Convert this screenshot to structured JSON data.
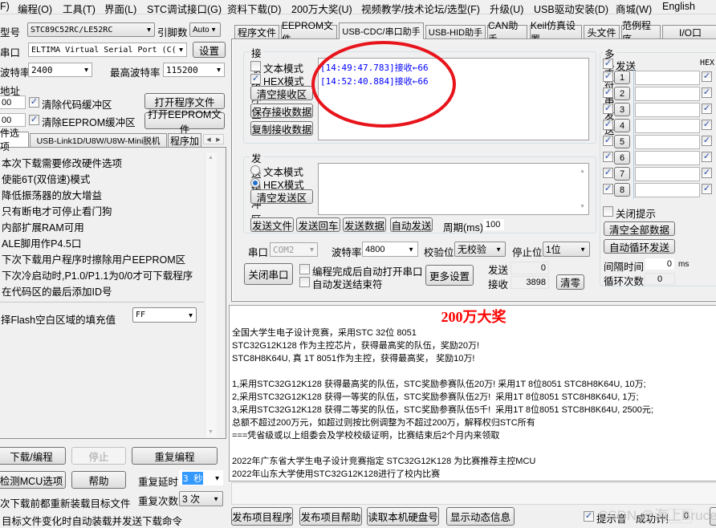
{
  "menu": [
    "F)",
    "编程(O)",
    "工具(T)",
    "界面(L)",
    "STC调试接口(G)",
    "资料下载(D)",
    "200万大奖(U)",
    "视频教学/技术论坛/选型(F)",
    "升级(U)",
    "USB驱动安装(D)",
    "商城(W)",
    "English"
  ],
  "left": {
    "chip_label": "型号",
    "chip_value": "STC89C52RC/LE52RC",
    "pins_label": "引脚数",
    "pins_value": "Auto",
    "port_label": "串口",
    "port_value": "ELTIMA Virtual Serial Port (C(",
    "settings_btn": "设置",
    "baud_label": "波特率",
    "baud_value": "2400",
    "max_baud_label": "最高波特率",
    "max_baud_value": "115200",
    "addr_label": "地址",
    "addr1": "00",
    "addr2": "00",
    "clear_code": "清除代码缓冲区",
    "clear_eeprom": "清除EEPROM缓冲区",
    "open_prog": "打开程序文件",
    "open_eeprom": "打开EEPROM文件",
    "tabs": [
      "件选项",
      "USB-Link1D/U8W/U8W-Mini脱机",
      "程序加"
    ],
    "options": [
      "本次下载需要修改硬件选项",
      "使能6T(双倍速)模式",
      "降低振荡器的放大增益",
      "只有断电才可停止看门狗",
      "内部扩展RAM可用",
      "ALE脚用作P4.5口",
      "下次下载用户程序时擦除用户EEPROM区",
      "下次冷启动时,P1.0/P1.1为0/0才可下载程序",
      "在代码区的最后添加ID号"
    ],
    "fill_label": "择Flash空白区域的填充值",
    "fill_value": "FF",
    "download_btn": "下载/编程",
    "stop_btn": "停止",
    "repeat_btn": "重复编程",
    "detect_btn": "检测MCU选项",
    "help_btn": "帮助",
    "delay_label": "重复延时",
    "delay_value": "3 秒",
    "count_label": "重复次数",
    "count_value": "3 次",
    "reload_text": "次下载前都重新装载目标文件",
    "auto_text": "目标文件变化时自动装载并发送下载命令"
  },
  "tabs": [
    "程序文件",
    "EEPROM文件",
    "USB-CDC/串口助手",
    "USB-HID助手",
    "CAN助手",
    "Keil仿真设置",
    "头文件",
    "范例程序",
    "I/O口"
  ],
  "recv": {
    "title": "接收缓冲区",
    "text_mode": "文本模式",
    "hex_mode": "HEX模式",
    "clear": "清空接收区",
    "save": "保存接收数据",
    "copy": "复制接收数据",
    "lines": [
      "[14:49:47.783]接收←66",
      "[14:52:40.884]接收←66"
    ],
    "text_color": "#0000ff",
    "annotation_color": "#e8141c"
  },
  "send": {
    "title": "发送缓冲区",
    "text_mode": "文本模式",
    "hex_mode": "HEX模式",
    "clear": "清空发送区",
    "send_file": "发送文件",
    "send_cr": "发送回车",
    "send_data": "发送数据",
    "auto_send": "自动发送",
    "period_label": "周期(ms)",
    "period_value": "100"
  },
  "serial": {
    "port_label": "串口",
    "port_value": "COM2",
    "baud_label": "波特率",
    "baud_value": "4800",
    "parity_label": "校验位",
    "parity_value": "无校验",
    "stop_label": "停止位",
    "stop_value": "1位",
    "close_btn": "关闭串口",
    "auto_open": "编程完成后自动打开串口",
    "auto_end": "自动发送结束符",
    "more_btn": "更多设置",
    "sent_label": "发送",
    "sent_value": "0",
    "recv_label": "接收",
    "recv_value": "3898",
    "clear_btn": "清零"
  },
  "multi": {
    "title": "多字符串发送",
    "send_label": "发送",
    "hex_label": "HEX",
    "rows": [
      "1",
      "2",
      "3",
      "4",
      "5",
      "6",
      "7",
      "8"
    ],
    "close_tip": "关闭提示",
    "clear_all": "清空全部数据",
    "loop_send": "自动循环发送",
    "interval_label": "间隔时间",
    "interval_value": "0",
    "interval_unit": "ms",
    "loop_label": "循环次数",
    "loop_value": "0"
  },
  "info": {
    "title": "200万大奖",
    "title_color": "#ff0000",
    "lines": [
      "全国大学生电子设计竞赛，采用STC 32位 8051",
      "STC32G12K128 作为主控芯片，获得最高奖的队伍，奖励20万!",
      "STC8H8K64U, 真 1T 8051作为主控，获得最高奖， 奖励10万!",
      "",
      "1,采用STC32G12K128 获得最高奖的队伍，STC奖励参赛队伍20万! 采用1T 8位8051 STC8H8K64U, 10万;",
      "2,采用STC32G12K128 获得一等奖的队伍，STC奖励参赛队伍2万!  采用1T 8位8051 STC8H8K64U, 1万;",
      "3,采用STC32G12K128 获得二等奖的队伍，STC奖励参赛队伍5千!  采用1T 8位8051 STC8H8K64U, 2500元;",
      "总额不超过200万元，如超过则按比例调整为不超过200万，解释权归STC所有",
      "===凭省级或以上组委会及学校校级证明，比赛结束后2个月内来领取",
      "",
      "2022年广东省大学生电子设计竞赛指定 STC32G12K128 为比赛推荐主控MCU",
      "2022年山东大学使用STC32G12K128进行了校内比赛"
    ]
  },
  "bottom": {
    "publish_prog": "发布项目程序",
    "publish_help": "发布项目帮助",
    "read_disk": "读取本机硬盘号",
    "show_info": "显示动态信息",
    "beep": "提示音",
    "success_label": "成功计数",
    "success_value": "0",
    "watermark": "CSDN @海上Bruce"
  }
}
